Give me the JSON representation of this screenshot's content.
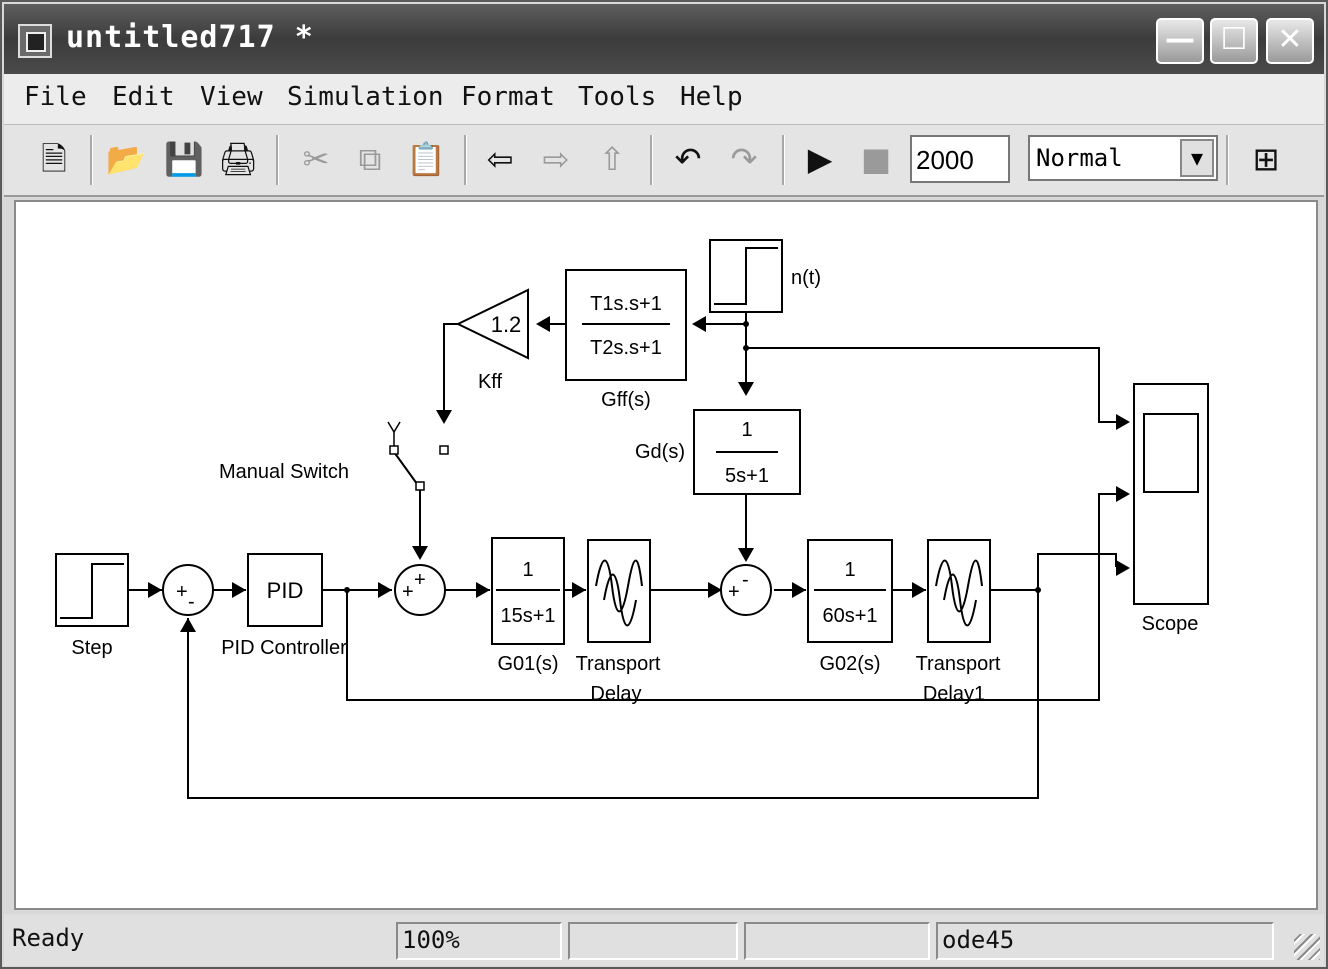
{
  "window": {
    "title": "untitled717 *"
  },
  "menu": [
    {
      "label": "File"
    },
    {
      "label": "Edit"
    },
    {
      "label": "View"
    },
    {
      "label": "Simulation"
    },
    {
      "label": "Format"
    },
    {
      "label": "Tools"
    },
    {
      "label": "Help"
    }
  ],
  "toolbar": {
    "stop_time": "2000",
    "sim_mode": "Normal",
    "icons": [
      "new-icon",
      "open-icon",
      "save-icon",
      "print-icon",
      "cut-icon",
      "copy-icon",
      "paste-icon",
      "back-icon",
      "forward-icon",
      "up-icon",
      "undo-icon",
      "redo-icon",
      "start-icon",
      "stop-icon",
      "library-icon"
    ]
  },
  "diagram": {
    "step_label": "Step",
    "pid_text": "PID",
    "pid_label": "PID Controller",
    "switch_label": "Manual Switch",
    "kff_gain": "1.2",
    "kff_label": "Kff",
    "gff_num": "T1s.s+1",
    "gff_den": "T2s.s+1",
    "gff_label": "Gff(s)",
    "nt_label": "n(t)",
    "gd_num": "1",
    "gd_den": "5s+1",
    "gd_label": "Gd(s)",
    "g01_num": "1",
    "g01_den": "15s+1",
    "g01_label": "G01(s)",
    "td1_label_1": "Transport",
    "td1_label_2": "Delay",
    "g02_num": "1",
    "g02_den": "60s+1",
    "g02_label": "G02(s)",
    "td2_label_1": "Transport",
    "td2_label_2": "Delay1",
    "scope_label": "Scope",
    "sum_plus": "+",
    "sum_minus": "-"
  },
  "status": {
    "state": "Ready",
    "zoom": "100%",
    "solver": "ode45"
  }
}
